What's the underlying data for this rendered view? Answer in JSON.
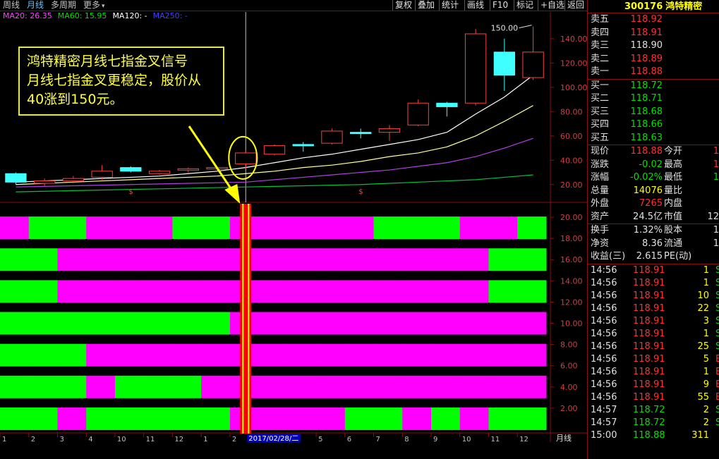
{
  "toolbar": {
    "tabs": [
      "周线",
      "月线",
      "多周期",
      "更多"
    ],
    "buttons": [
      "复权",
      "叠加",
      "统计",
      "画线",
      "F10",
      "标记",
      "+自选",
      "返回"
    ]
  },
  "ma_legend": {
    "ma20": "MA20: 26.35",
    "ma60": "MA60: 15.95",
    "ma120": "MA120: -",
    "ma250": "MA250: -",
    "colors": {
      "ma20": "#ff40ff",
      "ma60": "#00e000",
      "ma120": "#ffffff",
      "ma250": "#4040ff"
    }
  },
  "annotation": {
    "lines": [
      "鸿特精密月线七指金叉信号",
      "月线七指金叉更稳定，股价从",
      "40涨到150元。"
    ]
  },
  "chart_data": {
    "type": "candlestick",
    "price_axis": {
      "ticks": [
        "140.00",
        "120.00",
        "100.00",
        "80.00",
        "60.00",
        "40.00",
        "20.00"
      ],
      "range": [
        10,
        155
      ]
    },
    "indicator_axis": {
      "ticks": [
        "20.00",
        "18.00",
        "16.00",
        "14.00",
        "12.00",
        "10.00",
        "8.00",
        "6.00",
        "4.00",
        "2.00"
      ],
      "range": [
        0,
        21
      ]
    },
    "high_label": "150.00",
    "date_label": "2017/02/28/二",
    "period_label": "月线",
    "x_ticks": [
      "1",
      "2",
      "3",
      "4",
      "10",
      "11",
      "12",
      "1",
      "2",
      "3",
      "4",
      "5",
      "6",
      "7",
      "8",
      "9",
      "10",
      "11",
      "12"
    ],
    "candles": [
      {
        "o": 22,
        "c": 29,
        "h": 30,
        "l": 20,
        "color": "cyan"
      },
      {
        "o": 21,
        "c": 23,
        "h": 25,
        "l": 19,
        "color": "red"
      },
      {
        "o": 23,
        "c": 25,
        "h": 27,
        "l": 21,
        "color": "red"
      },
      {
        "o": 26,
        "c": 31,
        "h": 36,
        "l": 24,
        "color": "red"
      },
      {
        "o": 34,
        "c": 31,
        "h": 35,
        "l": 30,
        "color": "cyan"
      },
      {
        "o": 29,
        "c": 31,
        "h": 32,
        "l": 28,
        "color": "red"
      },
      {
        "o": 32,
        "c": 33,
        "h": 34,
        "l": 30,
        "color": "red"
      },
      {
        "o": 33,
        "c": 34,
        "h": 35,
        "l": 32,
        "color": "red"
      },
      {
        "o": 37,
        "c": 46,
        "h": 48,
        "l": 33,
        "color": "red"
      },
      {
        "o": 45,
        "c": 52,
        "h": 53,
        "l": 44,
        "color": "red"
      },
      {
        "o": 53,
        "c": 52,
        "h": 55,
        "l": 47,
        "color": "cyan"
      },
      {
        "o": 54,
        "c": 64,
        "h": 66,
        "l": 53,
        "color": "red"
      },
      {
        "o": 63,
        "c": 62,
        "h": 66,
        "l": 58,
        "color": "cyan"
      },
      {
        "o": 63,
        "c": 66,
        "h": 69,
        "l": 56,
        "color": "red"
      },
      {
        "o": 69,
        "c": 87,
        "h": 90,
        "l": 68,
        "color": "red"
      },
      {
        "o": 87,
        "c": 84,
        "h": 88,
        "l": 76,
        "color": "cyan"
      },
      {
        "o": 87,
        "c": 144,
        "h": 148,
        "l": 85,
        "color": "red"
      },
      {
        "o": 129,
        "c": 110,
        "h": 140,
        "l": 97,
        "color": "cyan"
      },
      {
        "o": 108,
        "c": 129,
        "h": 150,
        "l": 106,
        "color": "red"
      }
    ],
    "ma_lines": {
      "white": [
        22,
        23,
        24,
        25,
        26,
        27,
        29,
        31,
        34,
        38,
        42,
        45,
        49,
        53,
        57,
        63,
        78,
        92,
        110
      ],
      "yellow": [
        20,
        21,
        22,
        23,
        24,
        25,
        26,
        27,
        29,
        31,
        34,
        36,
        39,
        43,
        46,
        51,
        60,
        72,
        85
      ],
      "purple": [
        18,
        18.5,
        19,
        19.5,
        20,
        20.5,
        21,
        21.5,
        22,
        24,
        26,
        28,
        30,
        32,
        35,
        38,
        43,
        50,
        58
      ],
      "green": [
        14,
        14.5,
        15,
        15.5,
        16,
        16.5,
        17,
        17.5,
        18,
        18.5,
        19,
        19.5,
        20,
        21,
        22,
        23,
        24,
        26,
        28
      ]
    },
    "indicator_rows": [
      {
        "level": 19,
        "segments": [
          "m",
          "g",
          "g",
          "m",
          "m",
          "m",
          "g",
          "g",
          "m",
          "m",
          "m",
          "m",
          "m",
          "g",
          "g",
          "g",
          "m",
          "m",
          "g"
        ]
      },
      {
        "level": 16,
        "segments": [
          "g",
          "g",
          "m",
          "m",
          "m",
          "m",
          "m",
          "m",
          "m",
          "m",
          "m",
          "m",
          "m",
          "m",
          "m",
          "m",
          "m",
          "g",
          "g"
        ]
      },
      {
        "level": 13,
        "segments": [
          "g",
          "g",
          "m",
          "m",
          "m",
          "m",
          "m",
          "m",
          "m",
          "m",
          "m",
          "m",
          "m",
          "m",
          "m",
          "m",
          "m",
          "g",
          "g"
        ]
      },
      {
        "level": 10,
        "segments": [
          "g",
          "g",
          "g",
          "g",
          "g",
          "g",
          "g",
          "g",
          "m",
          "m",
          "m",
          "m",
          "m",
          "m",
          "m",
          "m",
          "m",
          "m",
          "m"
        ]
      },
      {
        "level": 7,
        "segments": [
          "g",
          "g",
          "g",
          "m",
          "m",
          "m",
          "m",
          "m",
          "m",
          "m",
          "m",
          "m",
          "m",
          "m",
          "m",
          "m",
          "m",
          "m",
          "m"
        ]
      },
      {
        "level": 4,
        "segments": [
          "g",
          "g",
          "g",
          "m",
          "g",
          "g",
          "g",
          "m",
          "m",
          "m",
          "m",
          "m",
          "m",
          "m",
          "m",
          "m",
          "m",
          "m",
          "m"
        ]
      },
      {
        "level": 1,
        "segments": [
          "g",
          "g",
          "m",
          "g",
          "g",
          "g",
          "g",
          "g",
          "m",
          "m",
          "m",
          "m",
          "g",
          "g",
          "m",
          "g",
          "m",
          "g",
          "g"
        ]
      }
    ]
  },
  "quote": {
    "code": "300176",
    "name": "鸿特精密",
    "asks": [
      {
        "label": "卖五",
        "price": "118.92"
      },
      {
        "label": "卖四",
        "price": "118.91"
      },
      {
        "label": "卖三",
        "price": "118.90"
      },
      {
        "label": "卖二",
        "price": "118.89"
      },
      {
        "label": "卖一",
        "price": "118.88"
      }
    ],
    "bids": [
      {
        "label": "买一",
        "price": "118.72"
      },
      {
        "label": "买二",
        "price": "118.71"
      },
      {
        "label": "买三",
        "price": "118.68"
      },
      {
        "label": "买四",
        "price": "118.66"
      },
      {
        "label": "买五",
        "price": "118.63"
      }
    ],
    "stats": [
      {
        "l1": "现价",
        "v1": "118.88",
        "c1": "red",
        "l2": "今开",
        "v2": "1",
        "c2": "red"
      },
      {
        "l1": "涨跌",
        "v1": "-0.02",
        "c1": "green",
        "l2": "最高",
        "v2": "1",
        "c2": "red"
      },
      {
        "l1": "涨幅",
        "v1": "-0.02%",
        "c1": "green",
        "l2": "最低",
        "v2": "1",
        "c2": "green"
      },
      {
        "l1": "总量",
        "v1": "14076",
        "c1": "yellow",
        "l2": "量比",
        "v2": "",
        "c2": "white"
      },
      {
        "l1": "外盘",
        "v1": "7265",
        "c1": "red",
        "l2": "内盘",
        "v2": "",
        "c2": "green"
      },
      {
        "l1": "资产",
        "v1": "24.5亿",
        "c1": "white",
        "l2": "市值",
        "v2": "12",
        "c2": "white"
      }
    ],
    "fundamentals": [
      {
        "l1": "换手",
        "v1": "1.32%",
        "l2": "股本",
        "v2": "1"
      },
      {
        "l1": "净资",
        "v1": "8.36",
        "l2": "流通",
        "v2": "1"
      },
      {
        "l1": "收益(三)",
        "v1": "2.615",
        "l2": "PE(动)",
        "v2": ""
      }
    ],
    "ticks": [
      {
        "time": "14:56",
        "price": "118.91",
        "vol": "1",
        "bs": "S",
        "pc": "red"
      },
      {
        "time": "14:56",
        "price": "118.91",
        "vol": "1",
        "bs": "S",
        "pc": "red"
      },
      {
        "time": "14:56",
        "price": "118.91",
        "vol": "10",
        "bs": "S",
        "pc": "red"
      },
      {
        "time": "14:56",
        "price": "118.91",
        "vol": "22",
        "bs": "S",
        "pc": "red"
      },
      {
        "time": "14:56",
        "price": "118.91",
        "vol": "3",
        "bs": "S",
        "pc": "red"
      },
      {
        "time": "14:56",
        "price": "118.91",
        "vol": "1",
        "bs": "S",
        "pc": "red"
      },
      {
        "time": "14:56",
        "price": "118.91",
        "vol": "25",
        "bs": "S",
        "pc": "red"
      },
      {
        "time": "14:56",
        "price": "118.91",
        "vol": "5",
        "bs": "B",
        "pc": "red"
      },
      {
        "time": "14:56",
        "price": "118.91",
        "vol": "1",
        "bs": "B",
        "pc": "red"
      },
      {
        "time": "14:56",
        "price": "118.91",
        "vol": "9",
        "bs": "B",
        "pc": "red"
      },
      {
        "time": "14:56",
        "price": "118.91",
        "vol": "55",
        "bs": "B",
        "pc": "red"
      },
      {
        "time": "14:57",
        "price": "118.72",
        "vol": "2",
        "bs": "S",
        "pc": "green"
      },
      {
        "time": "14:57",
        "price": "118.72",
        "vol": "2",
        "bs": "S",
        "pc": "green"
      },
      {
        "time": "15:00",
        "price": "118.88",
        "vol": "311",
        "bs": "",
        "pc": "green"
      }
    ]
  }
}
